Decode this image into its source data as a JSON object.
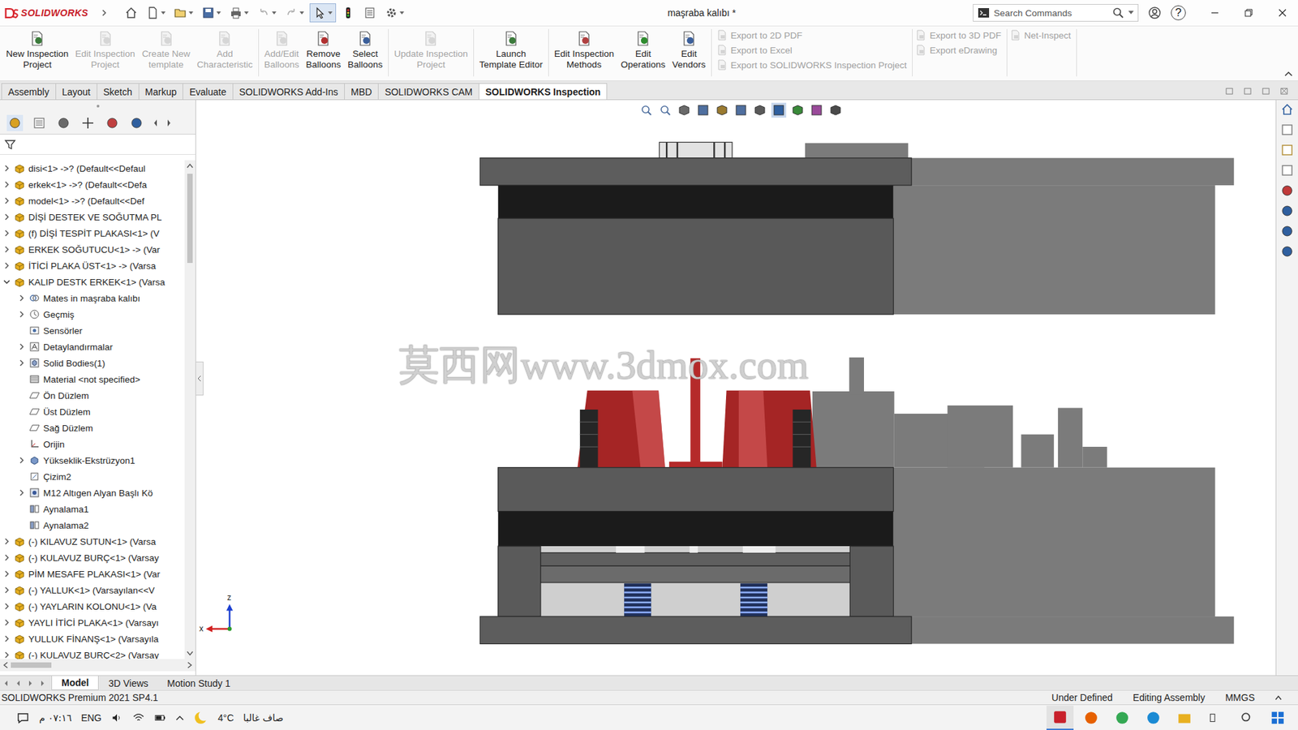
{
  "app": {
    "logo": "SOLIDWORKS",
    "title": "maşraba kalıbı *",
    "search_placeholder": "Search Commands",
    "help": "?"
  },
  "ribbon": {
    "groups": [
      {
        "buttons": [
          {
            "lines": [
              "New Inspection",
              "Project"
            ],
            "disabled": false
          },
          {
            "lines": [
              "Edit Inspection",
              "Project"
            ],
            "disabled": true
          },
          {
            "lines": [
              "Create New",
              "template"
            ],
            "disabled": true
          },
          {
            "lines": [
              "Add",
              "Characteristic"
            ],
            "disabled": true
          }
        ]
      },
      {
        "buttons": [
          {
            "lines": [
              "Add/Edit",
              "Balloons"
            ],
            "disabled": true
          },
          {
            "lines": [
              "Remove",
              "Balloons"
            ],
            "disabled": false
          },
          {
            "lines": [
              "Select",
              "Balloons"
            ],
            "disabled": false
          }
        ]
      },
      {
        "buttons": [
          {
            "lines": [
              "Update Inspection",
              "Project"
            ],
            "disabled": true
          }
        ]
      },
      {
        "buttons": [
          {
            "lines": [
              "Launch",
              "Template Editor"
            ],
            "disabled": false
          }
        ]
      },
      {
        "buttons": [
          {
            "lines": [
              "Edit Inspection",
              "Methods"
            ],
            "disabled": false
          },
          {
            "lines": [
              "Edit",
              "Operations"
            ],
            "disabled": false
          },
          {
            "lines": [
              "Edit",
              "Vendors"
            ],
            "disabled": false
          }
        ]
      }
    ],
    "export_columns": [
      [
        {
          "label": "Export to 2D PDF",
          "disabled": true
        },
        {
          "label": "Export to Excel",
          "disabled": true
        },
        {
          "label": "Export to SOLIDWORKS Inspection Project",
          "disabled": true
        }
      ],
      [
        {
          "label": "Export to 3D PDF",
          "disabled": true
        },
        {
          "label": "Export eDrawing",
          "disabled": true
        }
      ],
      [
        {
          "label": "Net-Inspect",
          "disabled": true
        }
      ]
    ]
  },
  "tabs": [
    {
      "label": "Assembly",
      "selected": false
    },
    {
      "label": "Layout",
      "selected": false
    },
    {
      "label": "Sketch",
      "selected": false
    },
    {
      "label": "Markup",
      "selected": false
    },
    {
      "label": "Evaluate",
      "selected": false
    },
    {
      "label": "SOLIDWORKS Add-Ins",
      "selected": false
    },
    {
      "label": "MBD",
      "selected": false
    },
    {
      "label": "SOLIDWORKS CAM",
      "selected": false
    },
    {
      "label": "SOLIDWORKS Inspection",
      "selected": true
    }
  ],
  "tree": {
    "items": [
      {
        "label": "disi<1> ->? (Default<<Defaul",
        "depth": 0,
        "kind": "component",
        "expandable": true,
        "expanded": false
      },
      {
        "label": "erkek<1> ->? (Default<<Defa",
        "depth": 0,
        "kind": "component",
        "expandable": true,
        "expanded": false
      },
      {
        "label": "model<1> ->? (Default<<Def",
        "depth": 0,
        "kind": "component",
        "expandable": true,
        "expanded": false
      },
      {
        "label": "DİŞİ DESTEK VE SOĞUTMA PL",
        "depth": 0,
        "kind": "component",
        "expandable": true,
        "expanded": false
      },
      {
        "label": "(f) DİŞİ TESPİT PLAKASI<1> (V",
        "depth": 0,
        "kind": "component",
        "expandable": true,
        "expanded": false
      },
      {
        "label": "ERKEK SOĞUTUCU<1> -> (Var",
        "depth": 0,
        "kind": "component",
        "expandable": true,
        "expanded": false
      },
      {
        "label": "İTİCİ PLAKA ÜST<1> -> (Varsa",
        "depth": 0,
        "kind": "component",
        "expandable": true,
        "expanded": false
      },
      {
        "label": "KALIP DESTK ERKEK<1> (Varsa",
        "depth": 0,
        "kind": "component",
        "expandable": true,
        "expanded": true
      },
      {
        "label": "Mates in maşraba kalıbı",
        "depth": 1,
        "kind": "mates",
        "expandable": true,
        "expanded": false
      },
      {
        "label": "Geçmiş",
        "depth": 1,
        "kind": "history",
        "expandable": true,
        "expanded": false
      },
      {
        "label": "Sensörler",
        "depth": 1,
        "kind": "sensor",
        "expandable": false,
        "expanded": false
      },
      {
        "label": "Detaylandırmalar",
        "depth": 1,
        "kind": "annotation",
        "expandable": true,
        "expanded": false
      },
      {
        "label": "Solid Bodies(1)",
        "depth": 1,
        "kind": "bodies",
        "expandable": true,
        "expanded": false
      },
      {
        "label": "Material <not specified>",
        "depth": 1,
        "kind": "material",
        "expandable": false,
        "expanded": false
      },
      {
        "label": "Ön Düzlem",
        "depth": 1,
        "kind": "plane",
        "expandable": false,
        "expanded": false
      },
      {
        "label": "Üst Düzlem",
        "depth": 1,
        "kind": "plane",
        "expandable": false,
        "expanded": false
      },
      {
        "label": "Sağ Düzlem",
        "depth": 1,
        "kind": "plane",
        "expandable": false,
        "expanded": false
      },
      {
        "label": "Orijin",
        "depth": 1,
        "kind": "origin",
        "expandable": false,
        "expanded": false
      },
      {
        "label": "Yükseklik-Ekstrüzyon1",
        "depth": 1,
        "kind": "feature",
        "expandable": true,
        "expanded": false
      },
      {
        "label": "Çizim2",
        "depth": 1,
        "kind": "sketch",
        "expandable": false,
        "expanded": false
      },
      {
        "label": "M12 Altıgen Alyan Başlı Kö",
        "depth": 1,
        "kind": "hole",
        "expandable": true,
        "expanded": false
      },
      {
        "label": "Aynalama1",
        "depth": 1,
        "kind": "mirror",
        "expandable": false,
        "expanded": false
      },
      {
        "label": "Aynalama2",
        "depth": 1,
        "kind": "mirror",
        "expandable": false,
        "expanded": false
      },
      {
        "label": "(-) KILAVUZ SUTUN<1> (Varsa",
        "depth": 0,
        "kind": "component",
        "expandable": true,
        "expanded": false
      },
      {
        "label": "(-) KULAVUZ BURÇ<1> (Varsay",
        "depth": 0,
        "kind": "component",
        "expandable": true,
        "expanded": false
      },
      {
        "label": "PİM MESAFE PLAKASI<1> (Var",
        "depth": 0,
        "kind": "component",
        "expandable": true,
        "expanded": false
      },
      {
        "label": "(-) YALLUK<1> (Varsayılan<<V",
        "depth": 0,
        "kind": "component",
        "expandable": true,
        "expanded": false
      },
      {
        "label": "(-) YAYLARIN  KOLONU<1> (Va",
        "depth": 0,
        "kind": "component",
        "expandable": true,
        "expanded": false
      },
      {
        "label": "YAYLI İTİCİ PLAKA<1> (Varsayı",
        "depth": 0,
        "kind": "component",
        "expandable": true,
        "expanded": false
      },
      {
        "label": "YULLUK FİNANŞ<1> (Varsayıla",
        "depth": 0,
        "kind": "component",
        "expandable": true,
        "expanded": false
      },
      {
        "label": "(-) KULAVUZ BURÇ<2> (Varsay",
        "depth": 0,
        "kind": "component",
        "expandable": true,
        "expanded": false
      }
    ]
  },
  "viewport": {
    "watermark": "莫西网www.3dmox.com",
    "axis_labels": {
      "z": "z",
      "x": "x"
    }
  },
  "bottom_tabs": [
    {
      "label": "Model",
      "selected": true
    },
    {
      "label": "3D Views",
      "selected": false
    },
    {
      "label": "Motion Study 1",
      "selected": false
    }
  ],
  "status_bar": {
    "product": "SOLIDWORKS Premium 2021 SP4.1",
    "items": [
      "Under Defined",
      "Editing Assembly",
      "MMGS"
    ]
  },
  "taskbar": {
    "time": "٠٧:١٦ م",
    "language": "ENG",
    "temperature": "4°C",
    "weather": "صاف غالبا"
  }
}
